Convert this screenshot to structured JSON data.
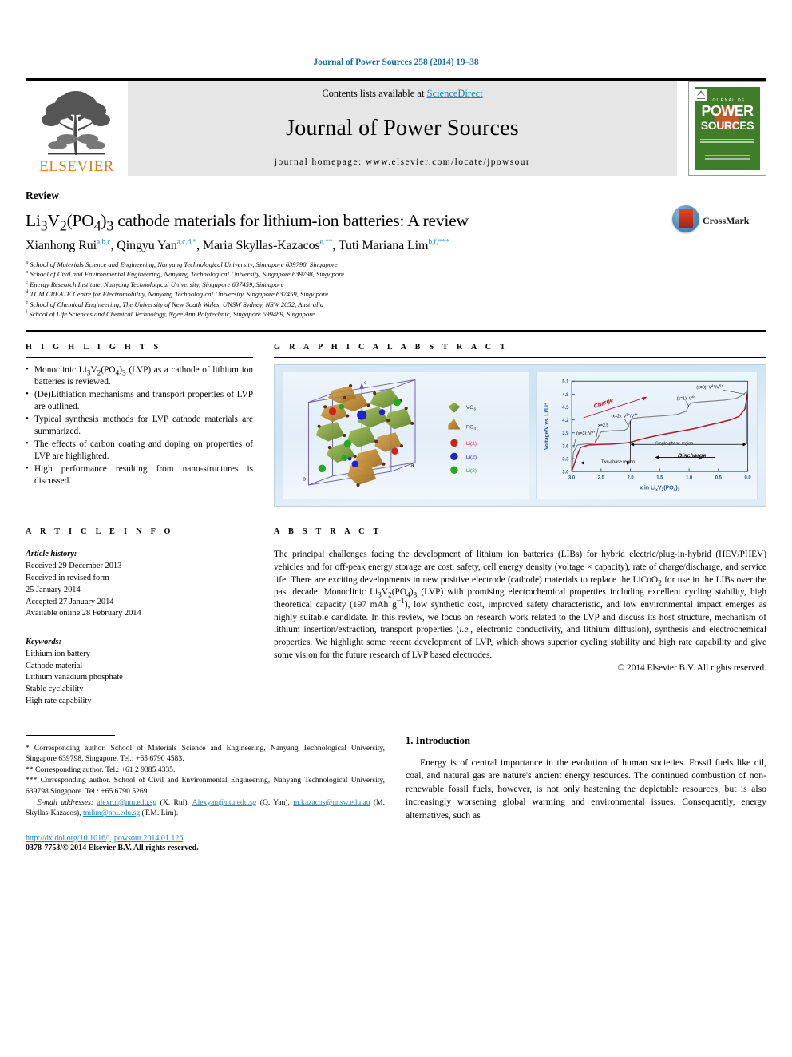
{
  "running_head": "Journal of Power Sources 258 (2014) 19–38",
  "masthead": {
    "publisher": "ELSEVIER",
    "contents_prefix": "Contents lists available at ",
    "contents_link": "ScienceDirect",
    "journal_name": "Journal of Power Sources",
    "homepage": "journal homepage: www.elsevier.com/locate/jpowsour",
    "cover": {
      "journal_of": "JOURNAL OF",
      "power": "POWER",
      "sources": "SOURCES"
    }
  },
  "article": {
    "doctype": "Review",
    "title_html": "Li<sub>3</sub>V<sub>2</sub>(PO<sub>4</sub>)<sub>3</sub> cathode materials for lithium-ion batteries: A review",
    "crossmark_label": "CrossMark",
    "authors": [
      {
        "name": "Xianhong Rui",
        "marks": "a,b,c"
      },
      {
        "name": "Qingyu Yan",
        "marks": "a,c,d,*"
      },
      {
        "name": "Maria Skyllas-Kazacos",
        "marks": "e,**"
      },
      {
        "name": "Tuti Mariana Lim",
        "marks": "b,f,***"
      }
    ],
    "affiliations": [
      {
        "mark": "a",
        "text": "School of Materials Science and Engineering, Nanyang Technological University, Singapore 639798, Singapore"
      },
      {
        "mark": "b",
        "text": "School of Civil and Environmental Engineering, Nanyang Technological University, Singapore 639798, Singapore"
      },
      {
        "mark": "c",
        "text": "Energy Research Institute, Nanyang Technological University, Singapore 637459, Singapore"
      },
      {
        "mark": "d",
        "text": "TUM CREATE Centre for Electromobility, Nanyang Technological University, Singapore 637459, Singapore"
      },
      {
        "mark": "e",
        "text": "School of Chemical Engineering, The University of New South Wales, UNSW Sydney, NSW 2052, Australia"
      },
      {
        "mark": "f",
        "text": "School of Life Sciences and Chemical Technology, Ngee Ann Polytechnic, Singapore 599489, Singapore"
      }
    ]
  },
  "highlights": {
    "heading": "H I G H L I G H T S",
    "items": [
      "Monoclinic Li3V2(PO4)3 (LVP) as a cathode of lithium ion batteries is reviewed.",
      "(De)Lithiation mechanisms and transport properties of LVP are outlined.",
      "Typical synthesis methods for LVP cathode materials are summarized.",
      "The effects of carbon coating and doping on properties of LVP are highlighted.",
      "High performance resulting from nano-structures is discussed."
    ]
  },
  "graphical_abstract": {
    "heading": "G R A P H I C A L   A B S T R A C T",
    "structure_legend": [
      {
        "label": "VO6",
        "color": "#7ea03c",
        "shape": "octahedron"
      },
      {
        "label": "PO4",
        "color": "#c08a2e",
        "shape": "tetrahedron"
      },
      {
        "label": "Li(1)",
        "color": "#cc2222",
        "shape": "sphere"
      },
      {
        "label": "Li(2)",
        "color": "#2222cc",
        "shape": "sphere"
      },
      {
        "label": "Li(3)",
        "color": "#22aa22",
        "shape": "sphere"
      }
    ],
    "axes_labels": {
      "a": "a",
      "b": "b",
      "c": "c"
    }
  },
  "chart_data": {
    "type": "line",
    "title": "",
    "xlabel": "x in LixV2(PO4)3",
    "ylabel": "Voltage/V vs. Li/Li+",
    "xticks": [
      "3.0",
      "2.5",
      "2.0",
      "1.5",
      "1.0",
      "0.5",
      "0.0"
    ],
    "yticks": [
      "3.0",
      "3.3",
      "3.6",
      "3.9",
      "4.2",
      "4.5",
      "4.8",
      "5.1"
    ],
    "xlim": [
      3.0,
      0.0
    ],
    "ylim": [
      3.0,
      5.1
    ],
    "grid": false,
    "legend_position": "none",
    "axis_color": "#1d4f8c",
    "series": [
      {
        "name": "Charge",
        "color": "#808080",
        "x": [
          3.0,
          2.97,
          2.9,
          2.75,
          2.6,
          2.58,
          2.5,
          2.3,
          2.1,
          2.05,
          2.0,
          1.95,
          1.8,
          1.6,
          1.4,
          1.2,
          1.05,
          1.0,
          0.95,
          0.8,
          0.6,
          0.4,
          0.2,
          0.08,
          0.03,
          0.0
        ],
        "y": [
          3.0,
          3.45,
          3.62,
          3.64,
          3.66,
          3.72,
          3.92,
          3.95,
          3.96,
          4.0,
          4.18,
          4.24,
          4.26,
          4.28,
          4.3,
          4.33,
          4.4,
          4.55,
          4.6,
          4.62,
          4.64,
          4.66,
          4.7,
          4.78,
          4.85,
          4.9
        ]
      },
      {
        "name": "Discharge",
        "color": "#b0152a",
        "x": [
          0.0,
          0.05,
          0.15,
          0.3,
          0.5,
          0.7,
          0.9,
          1.1,
          1.3,
          1.5,
          1.7,
          1.9,
          2.0,
          2.1,
          2.3,
          2.5,
          2.7,
          2.85,
          2.9,
          2.95,
          3.0
        ],
        "y": [
          4.8,
          4.45,
          4.28,
          4.2,
          4.13,
          4.07,
          4.0,
          3.95,
          3.9,
          3.85,
          3.79,
          3.72,
          3.68,
          3.66,
          3.64,
          3.63,
          3.62,
          3.56,
          3.4,
          3.2,
          3.0
        ]
      }
    ],
    "annotations": [
      {
        "text": "Charge",
        "x": 2.45,
        "y": 4.55,
        "rotation": -20,
        "color": "#b0152a"
      },
      {
        "text": "Discharge",
        "x": 0.95,
        "y": 3.33,
        "color": "#000000"
      },
      {
        "text": "(x=3): V3+",
        "x": 2.92,
        "y": 3.86,
        "color": "#000000"
      },
      {
        "text": "x=2.5",
        "x": 2.55,
        "y": 4.04,
        "color": "#000000"
      },
      {
        "text": "(x=2): V3+/V4+",
        "x": 2.1,
        "y": 4.26,
        "color": "#000000"
      },
      {
        "text": "(x=1): V4+",
        "x": 1.05,
        "y": 4.67,
        "color": "#000000"
      },
      {
        "text": "(x=0): V4+/V5+",
        "x": 0.42,
        "y": 4.93,
        "color": "#000000"
      },
      {
        "text": "Single-phase region",
        "x": 1.25,
        "y": 3.63,
        "color": "#000000"
      },
      {
        "text": "Two-phase region",
        "x": 2.5,
        "y": 3.2,
        "color": "#000000"
      }
    ]
  },
  "article_info": {
    "heading": "A R T I C L E   I N F O",
    "history_label": "Article history:",
    "history": [
      "Received 29 December 2013",
      "Received in revised form",
      "25 January 2014",
      "Accepted 27 January 2014",
      "Available online 28 February 2014"
    ],
    "keywords_label": "Keywords:",
    "keywords": [
      "Lithium ion battery",
      "Cathode material",
      "Lithium vanadium phosphate",
      "Stable cyclability",
      "High rate capability"
    ]
  },
  "abstract": {
    "heading": "A B S T R A C T",
    "text_html": "The principal challenges facing the development of lithium ion batteries (LIBs) for hybrid electric/plug-in-hybrid (HEV/PHEV) vehicles and for off-peak energy storage are cost, safety, cell energy density (voltage &times; capacity), rate of charge/discharge, and service life. There are exciting developments in new positive electrode (cathode) materials to replace the LiCoO<sub>2</sub> for use in the LIBs over the past decade. Monoclinic Li<sub>3</sub>V<sub>2</sub>(PO<sub>4</sub>)<sub>3</sub> (LVP) with promising electrochemical properties including excellent cycling stability, high theoretical capacity (197 mAh g<sup>&minus;1</sup>), low synthetic cost, improved safety characteristic, and low environmental impact emerges as highly suitable candidate. In this review, we focus on research work related to the LVP and discuss its host structure, mechanism of lithium insertion/extraction, transport properties (<i>i.e.</i>, electronic conductivity, and lithium diffusion), synthesis and electrochemical properties. We highlight some recent development of LVP, which shows superior cycling stability and high rate capability and give some vision for the future research of LVP based electrodes.",
    "copyright": "© 2014 Elsevier B.V. All rights reserved."
  },
  "footnotes": {
    "corr1": "* Corresponding author. School of Materials Science and Engineering, Nanyang Technological University, Singapore 639798, Singapore. Tel.: +65 6790 4583.",
    "corr2": "** Corresponding author. Tel.: +61 2 9385 4335.",
    "corr3": "*** Corresponding author. School of Civil and Environmental Engineering, Nanyang Technological University, 639798 Singapore. Tel.: +65 6790 5269.",
    "email_label": "E-mail addresses:",
    "emails": [
      {
        "addr": "alexrui@ntu.edu.sg",
        "who": "(X. Rui)"
      },
      {
        "addr": "Alexyan@ntu.edu.sg",
        "who": "(Q. Yan)"
      },
      {
        "addr": "m.kazacos@unsw.edu.au",
        "who": "(M. Skyllas-Kazacos)"
      },
      {
        "addr": "tmlim@ntu.edu.sg",
        "who": "(T.M. Lim)"
      }
    ],
    "doi": "http://dx.doi.org/10.1016/j.jpowsour.2014.01.126",
    "issn": "0378-7753/© 2014 Elsevier B.V. All rights reserved."
  },
  "introduction": {
    "heading": "1. Introduction",
    "paragraph": "Energy is of central importance in the evolution of human societies. Fossil fuels like oil, coal, and natural gas are nature's ancient energy resources. The continued combustion of non-renewable fossil fuels, however, is not only hastening the depletable resources, but is also increasingly worsening global warming and environmental issues. Consequently, energy alternatives, such as"
  }
}
